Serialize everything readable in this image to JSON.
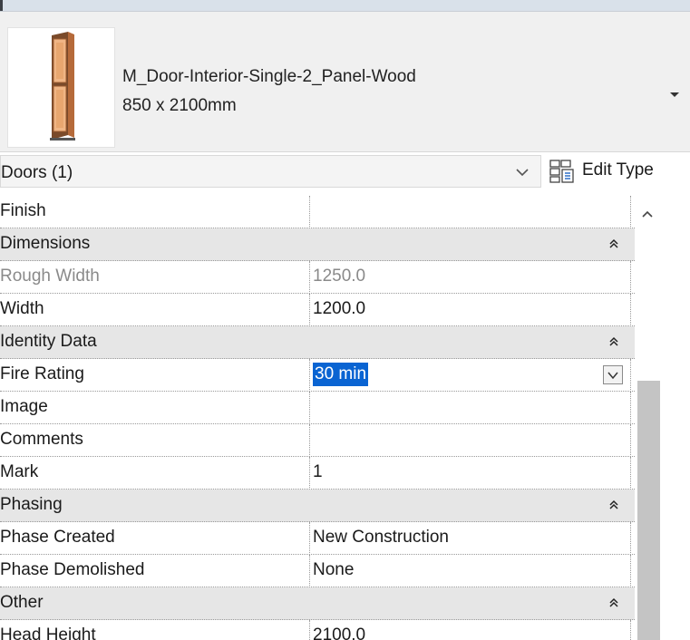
{
  "type_selector": {
    "family_name": "M_Door-Interior-Single-2_Panel-Wood",
    "type_size": "850 x 2100mm"
  },
  "filter": {
    "label": "Doors (1)",
    "edit_type_label": "Edit Type"
  },
  "rows": [
    {
      "kind": "param",
      "name": "Finish",
      "value": ""
    },
    {
      "kind": "group",
      "name": "Dimensions"
    },
    {
      "kind": "param",
      "name": "Rough Width",
      "value": "1250.0",
      "readonly": true
    },
    {
      "kind": "param",
      "name": "Width",
      "value": "1200.0"
    },
    {
      "kind": "group",
      "name": "Identity Data"
    },
    {
      "kind": "param",
      "name": "Fire Rating",
      "value": "30 min",
      "selected": true
    },
    {
      "kind": "param",
      "name": "Image",
      "value": ""
    },
    {
      "kind": "param",
      "name": "Comments",
      "value": ""
    },
    {
      "kind": "param",
      "name": "Mark",
      "value": "1"
    },
    {
      "kind": "group",
      "name": "Phasing"
    },
    {
      "kind": "param",
      "name": "Phase Created",
      "value": "New Construction"
    },
    {
      "kind": "param",
      "name": "Phase Demolished",
      "value": "None"
    },
    {
      "kind": "group",
      "name": "Other"
    },
    {
      "kind": "param",
      "name": "Head Height",
      "value": "2100.0"
    }
  ],
  "colors": {
    "selection": "#0a64d2",
    "group_band": "#e6e6e6",
    "readonly_text": "#8a8a8a",
    "door_wood": "#d98e57"
  },
  "icons": {
    "type_dropdown": "triangle-down-icon",
    "filter_dropdown": "chevron-down-icon",
    "edit_type": "edit-type-icon",
    "collapse_group": "double-chevron-up-icon",
    "scroll_up": "chevron-up-icon"
  }
}
